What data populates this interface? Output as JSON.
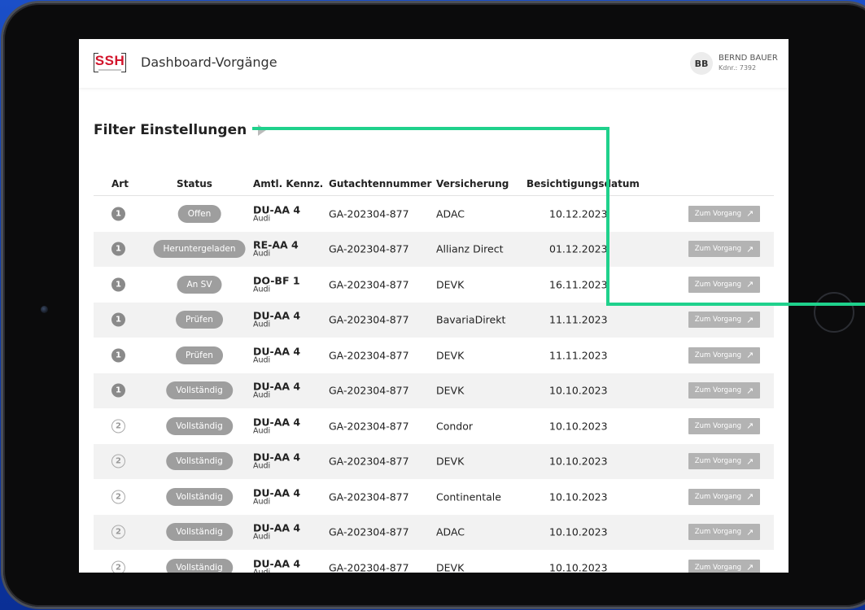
{
  "app": {
    "logo_text": "SSH",
    "title": "Dashboard-Vorgänge"
  },
  "user": {
    "initials": "BB",
    "name": "BERND BAUER",
    "kdnr": "Kdnr.: 7392"
  },
  "filter": {
    "label": "Filter Einstellungen",
    "icon": "chevron-right-icon"
  },
  "table": {
    "headers": {
      "art": "Art",
      "status": "Status",
      "kennz": "Amtl. Kennz.",
      "gutachten": "Gutachtennummer",
      "versicherung": "Versicherung",
      "datum": "Besichtigungsdatum"
    },
    "action_label": "Zum Vorgang",
    "action_icon": "external-link-icon",
    "rows": [
      {
        "art": "1",
        "status": "Offen",
        "plate": "DU-AA 4",
        "make": "Audi",
        "gutachten": "GA-202304-877",
        "versicherung": "ADAC",
        "datum": "10.12.2023"
      },
      {
        "art": "1",
        "status": "Heruntergeladen",
        "plate": "RE-AA 4",
        "make": "Audi",
        "gutachten": "GA-202304-877",
        "versicherung": "Allianz Direct",
        "datum": "01.12.2023"
      },
      {
        "art": "1",
        "status": "An SV",
        "plate": "DO-BF 1",
        "make": "Audi",
        "gutachten": "GA-202304-877",
        "versicherung": "DEVK",
        "datum": "16.11.2023"
      },
      {
        "art": "1",
        "status": "Prüfen",
        "plate": "DU-AA 4",
        "make": "Audi",
        "gutachten": "GA-202304-877",
        "versicherung": "BavariaDirekt",
        "datum": "11.11.2023"
      },
      {
        "art": "1",
        "status": "Prüfen",
        "plate": "DU-AA 4",
        "make": "Audi",
        "gutachten": "GA-202304-877",
        "versicherung": "DEVK",
        "datum": "11.11.2023"
      },
      {
        "art": "1",
        "status": "Vollständig",
        "plate": "DU-AA 4",
        "make": "Audi",
        "gutachten": "GA-202304-877",
        "versicherung": "DEVK",
        "datum": "10.10.2023"
      },
      {
        "art": "2",
        "status": "Vollständig",
        "plate": "DU-AA 4",
        "make": "Audi",
        "gutachten": "GA-202304-877",
        "versicherung": "Condor",
        "datum": "10.10.2023"
      },
      {
        "art": "2",
        "status": "Vollständig",
        "plate": "DU-AA 4",
        "make": "Audi",
        "gutachten": "GA-202304-877",
        "versicherung": "DEVK",
        "datum": "10.10.2023"
      },
      {
        "art": "2",
        "status": "Vollständig",
        "plate": "DU-AA 4",
        "make": "Audi",
        "gutachten": "GA-202304-877",
        "versicherung": "Continentale",
        "datum": "10.10.2023"
      },
      {
        "art": "2",
        "status": "Vollständig",
        "plate": "DU-AA 4",
        "make": "Audi",
        "gutachten": "GA-202304-877",
        "versicherung": "ADAC",
        "datum": "10.10.2023"
      },
      {
        "art": "2",
        "status": "Vollständig",
        "plate": "DU-AA 4",
        "make": "Audi",
        "gutachten": "GA-202304-877",
        "versicherung": "DEVK",
        "datum": "10.10.2023"
      }
    ]
  },
  "colors": {
    "logo_red": "#d2142b",
    "pill_gray": "#9e9e9e",
    "button_gray": "#b3b3b3",
    "callout_green": "#1fd18c",
    "background_blue": "#1b4fc8"
  }
}
